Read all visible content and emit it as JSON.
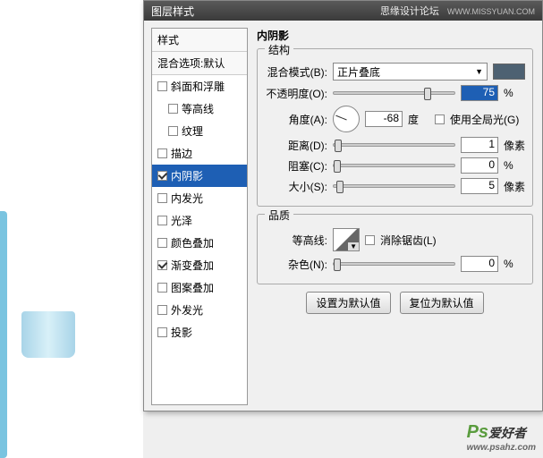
{
  "titlebar": {
    "title": "图层样式",
    "brand": "思缘设计论坛",
    "url": "WWW.MISSYUAN.COM"
  },
  "styleList": {
    "header": "样式",
    "blendDefault": "混合选项:默认",
    "items": [
      {
        "label": "斜面和浮雕",
        "checked": false,
        "sub": false
      },
      {
        "label": "等高线",
        "checked": false,
        "sub": true
      },
      {
        "label": "纹理",
        "checked": false,
        "sub": true
      },
      {
        "label": "描边",
        "checked": false,
        "sub": false
      },
      {
        "label": "内阴影",
        "checked": true,
        "sub": false,
        "selected": true
      },
      {
        "label": "内发光",
        "checked": false,
        "sub": false
      },
      {
        "label": "光泽",
        "checked": false,
        "sub": false
      },
      {
        "label": "颜色叠加",
        "checked": false,
        "sub": false
      },
      {
        "label": "渐变叠加",
        "checked": true,
        "sub": false
      },
      {
        "label": "图案叠加",
        "checked": false,
        "sub": false
      },
      {
        "label": "外发光",
        "checked": false,
        "sub": false
      },
      {
        "label": "投影",
        "checked": false,
        "sub": false
      }
    ]
  },
  "panel": {
    "title": "内阴影",
    "structure": "结构",
    "blendMode": {
      "label": "混合模式(B):",
      "value": "正片叠底",
      "color": "#4d6172"
    },
    "opacity": {
      "label": "不透明度(O):",
      "value": "75",
      "unit": "%",
      "pos": 75
    },
    "angle": {
      "label": "角度(A):",
      "value": "-68",
      "unit": "度",
      "global": "使用全局光(G)"
    },
    "distance": {
      "label": "距离(D):",
      "value": "1",
      "unit": "像素",
      "pos": 1
    },
    "choke": {
      "label": "阻塞(C):",
      "value": "0",
      "unit": "%",
      "pos": 0
    },
    "size": {
      "label": "大小(S):",
      "value": "5",
      "unit": "像素",
      "pos": 2
    },
    "quality": "品质",
    "contour": {
      "label": "等高线:",
      "antialias": "消除锯齿(L)"
    },
    "noise": {
      "label": "杂色(N):",
      "value": "0",
      "unit": "%",
      "pos": 0
    },
    "buttons": {
      "default": "设置为默认值",
      "reset": "复位为默认值"
    }
  },
  "watermark": {
    "logo": "Ps",
    "txt": "爱好者",
    "url": "www.psahz.com"
  }
}
